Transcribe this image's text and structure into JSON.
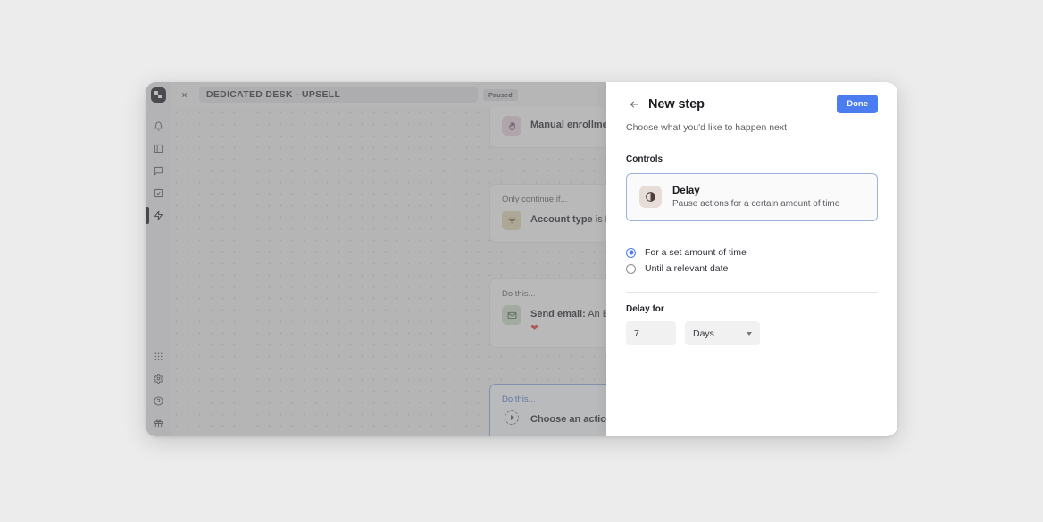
{
  "workflow": {
    "close_icon": "close-icon",
    "title": "DEDICATED DESK - UPSELL",
    "status_badge": "Paused"
  },
  "rail": {
    "logo": "brand-logo",
    "items": [
      {
        "icon": "bell-icon",
        "name": "notifications"
      },
      {
        "icon": "layout-panel-icon",
        "name": "dashboard"
      },
      {
        "icon": "message-square-icon",
        "name": "messages"
      },
      {
        "icon": "checklist-icon",
        "name": "tasks"
      },
      {
        "icon": "lightning-bolt-icon",
        "name": "automations",
        "active": true
      }
    ],
    "bottom_items": [
      {
        "icon": "grid-apps-icon",
        "name": "apps"
      },
      {
        "icon": "gear-icon",
        "name": "settings"
      },
      {
        "icon": "help-circle-icon",
        "name": "help"
      },
      {
        "icon": "gift-icon",
        "name": "whats-new"
      }
    ]
  },
  "flow": {
    "nodes": [
      {
        "label": "",
        "icon": "hand-icon",
        "title": "Manual enrollment",
        "detail": "",
        "emoji": ""
      },
      {
        "label": "Only continue if...",
        "icon": "filter-icon",
        "title": "Account type",
        "connector_word": "is",
        "detail": "Hot Desk Member",
        "emoji": ""
      },
      {
        "label": "Do this...",
        "icon": "envelope-icon",
        "title": "Send email:",
        "detail": "An Exclusive Offer Just For You",
        "emoji": "❤"
      },
      {
        "label": "Do this...",
        "icon": "play-circle-icon",
        "title": "Choose an action",
        "detail": "",
        "emoji": ""
      }
    ],
    "add_step_glyph": "+"
  },
  "panel": {
    "back_icon": "arrow-left-icon",
    "title": "New step",
    "done_label": "Done",
    "subtitle": "Choose what you'd like to happen next",
    "section_heading": "Controls",
    "option": {
      "icon": "delay-clock-icon",
      "title": "Delay",
      "description": "Pause actions for a certain amount of time"
    },
    "radios": [
      {
        "label": "For a set amount of time",
        "checked": true
      },
      {
        "label": "Until a relevant date",
        "checked": false
      }
    ],
    "delay_for_label": "Delay for",
    "delay_amount": "7",
    "delay_unit": "Days"
  },
  "colors": {
    "accent_blue": "#4b7df0",
    "selected_border": "#9db4e0",
    "page_background": "#ececec"
  }
}
